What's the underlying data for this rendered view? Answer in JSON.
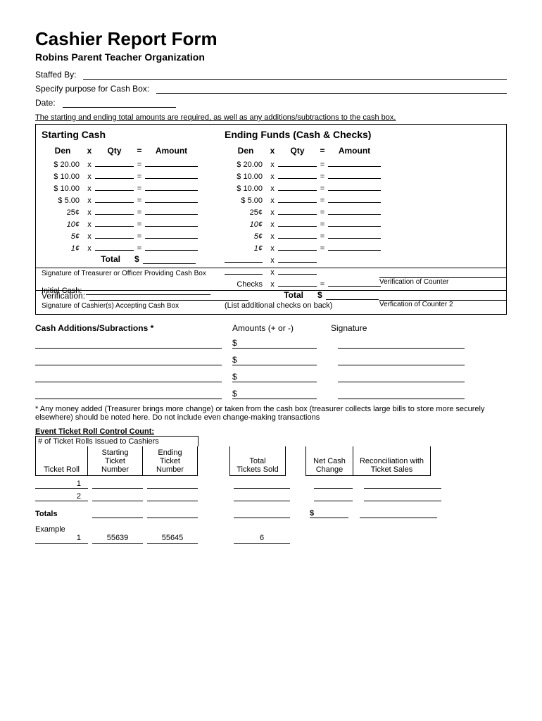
{
  "header": {
    "title": "Cashier Report Form",
    "subtitle": "Robins Parent Teacher Organization",
    "staffed_by_label": "Staffed By:",
    "purpose_label": "Specify purpose for Cash Box:",
    "date_label": "Date:",
    "required_note": "The starting and ending total amounts are required, as well as any additions/subtractions to the cash box."
  },
  "starting": {
    "title": "Starting Cash",
    "den_hdr": "Den",
    "x_hdr": "x",
    "qty_hdr": "Qty",
    "eq_hdr": "=",
    "amt_hdr": "Amount",
    "rows": [
      {
        "den": "$      20.00"
      },
      {
        "den": "$      10.00"
      },
      {
        "den": "$      10.00"
      },
      {
        "den": "$        5.00"
      },
      {
        "den": "25¢"
      },
      {
        "den": "10¢"
      },
      {
        "den": "5¢"
      },
      {
        "den": "1¢"
      }
    ],
    "total_label": "Total",
    "dollar": "$"
  },
  "ending": {
    "title": "Ending Funds (Cash & Checks)",
    "rows": [
      {
        "den": "$      20.00"
      },
      {
        "den": "$      10.00"
      },
      {
        "den": "$      10.00"
      },
      {
        "den": "$        5.00"
      },
      {
        "den": "25¢"
      },
      {
        "den": "10¢"
      },
      {
        "den": "5¢"
      },
      {
        "den": "1¢"
      }
    ],
    "checks_label": "Checks",
    "total_label": "Total",
    "dollar": "$",
    "checks_note": "(List additional checks on back)"
  },
  "sig": {
    "initial_cash_label": "Initial Cash:",
    "treasurer_caption": "Signature of Treasurer or Officer Providing Cash Box",
    "verification_counter": "Verification of Counter",
    "verification_label": "Verification:",
    "cashier_caption": "Signature of Cashier(s) Accepting Cash Box",
    "verification_counter2": "Verfication of Counter 2"
  },
  "adds": {
    "title": "Cash Additions/Subractions *",
    "amounts_hdr": "Amounts (+ or -)",
    "sig_hdr": "Signature",
    "dollar": "$",
    "footnote": "* Any money added (Treasurer brings more change) or taken from the cash box (treasurer collects large bills to store more securely elsewhere) should be noted here. Do not include even change-making transactions"
  },
  "roll": {
    "title": "Event Ticket Roll Control Count:",
    "issued_label": "# of Ticket Rolls Issued to Cashiers",
    "h1": "Ticket Roll",
    "h2a": "Starting",
    "h2b": "Ticket",
    "h2c": "Number",
    "h3a": "Ending",
    "h3b": "Ticket",
    "h3c": "Number",
    "h4a": "Total",
    "h4b": "Tickets Sold",
    "h5a": "Net Cash",
    "h5b": "Change",
    "h6a": "Reconciliation with",
    "h6b": "Ticket Sales",
    "r1": "1",
    "r2": "2",
    "totals_label": "Totals",
    "dollar": "$",
    "example_label": "Example",
    "ex_roll": "1",
    "ex_start": "55639",
    "ex_end": "55645",
    "ex_sold": "6"
  }
}
